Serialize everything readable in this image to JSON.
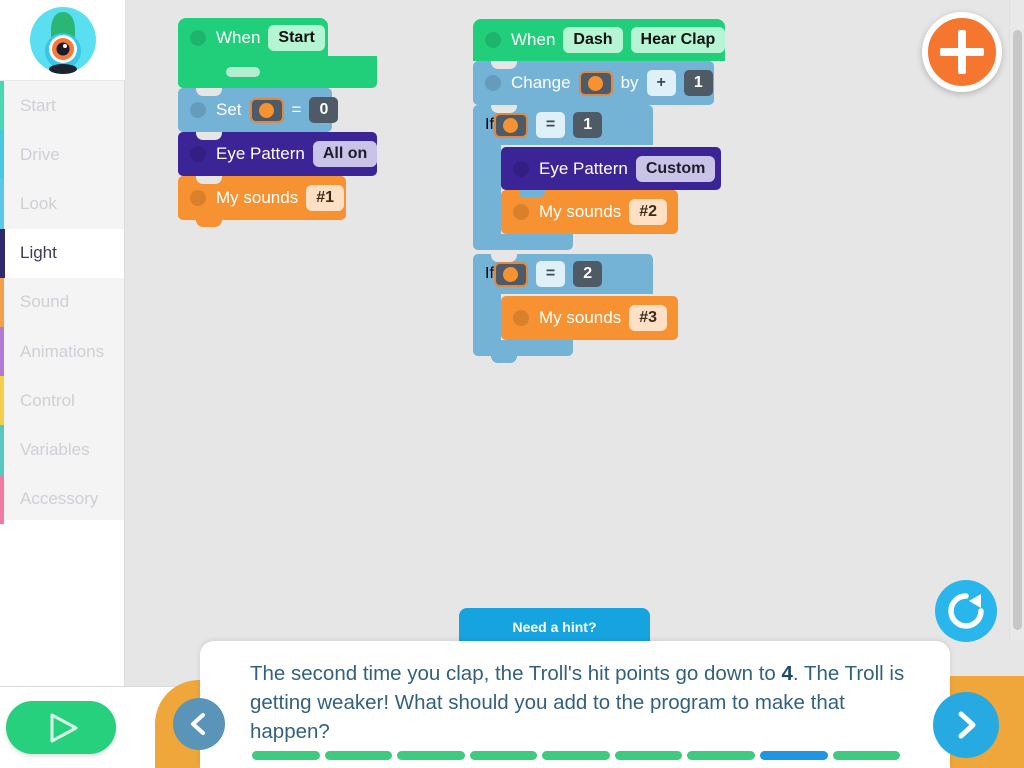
{
  "app": {
    "robot_avatar": "dash-robot-avatar",
    "workspace_bg": "#e6e6e6"
  },
  "sidebar": {
    "items": [
      {
        "label": "Start",
        "accent": "#4ad8b0",
        "active": false
      },
      {
        "label": "Drive",
        "accent": "#45c8e0",
        "active": false
      },
      {
        "label": "Look",
        "accent": "#5bc8e8",
        "active": false
      },
      {
        "label": "Light",
        "accent": "#2e2a6b",
        "active": true
      },
      {
        "label": "Sound",
        "accent": "#f4a04a",
        "active": false
      },
      {
        "label": "Animations",
        "accent": "#b07ad6",
        "active": false
      },
      {
        "label": "Control",
        "accent": "#f2d04a",
        "active": false
      },
      {
        "label": "Variables",
        "accent": "#56c8c0",
        "active": false
      },
      {
        "label": "Accessory",
        "accent": "#f07aa0",
        "active": false
      }
    ]
  },
  "toolbar": {
    "add_label": "add-block-button",
    "reset_label": "reset-program-button",
    "play_label": "play-button"
  },
  "programs": [
    {
      "name": "start-program",
      "blocks": {
        "hat": {
          "when": "When",
          "event": "Start"
        },
        "set": {
          "label": "Set",
          "variable": "variable-orange",
          "op": "=",
          "value": "0"
        },
        "eye": {
          "label": "Eye Pattern",
          "value": "All on"
        },
        "sound": {
          "label": "My sounds",
          "value": "#1"
        }
      }
    },
    {
      "name": "clap-program",
      "blocks": {
        "hat": {
          "when": "When",
          "robot": "Dash",
          "event": "Hear Clap"
        },
        "change": {
          "label": "Change",
          "variable": "variable-orange",
          "by": "by",
          "op": "+",
          "value": "1"
        },
        "if1": {
          "label": "If",
          "variable": "variable-orange",
          "op": "=",
          "value": "1",
          "body": [
            {
              "type": "light",
              "label": "Eye Pattern",
              "value": "Custom"
            },
            {
              "type": "sound",
              "label": "My sounds",
              "value": "#2"
            }
          ]
        },
        "if2": {
          "label": "If",
          "variable": "variable-orange",
          "op": "=",
          "value": "2",
          "body": [
            {
              "type": "sound",
              "label": "My sounds",
              "value": "#3"
            }
          ]
        }
      }
    }
  ],
  "hint": {
    "button_label": "Need a hint?"
  },
  "instruction": {
    "text_before": "The second time you clap, the Troll's hit points go down to ",
    "emphasis": "4",
    "text_after": ". The Troll is getting weaker! What should you add to the program to make that happen?"
  },
  "navigation": {
    "prev_label": "previous-step",
    "next_label": "next-step"
  },
  "progress": {
    "total": 9,
    "current_index": 7,
    "done_color": "#3fcb7f",
    "current_color": "#2196e0"
  }
}
